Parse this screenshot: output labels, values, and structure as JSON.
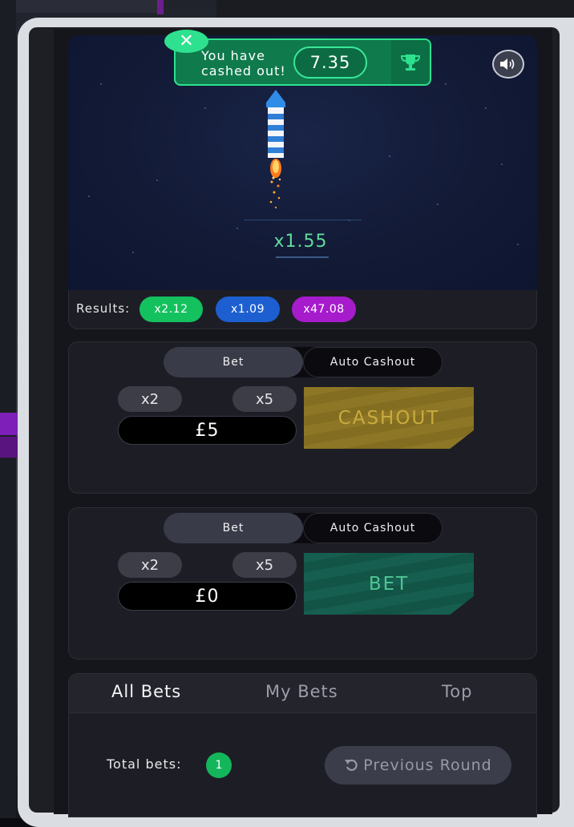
{
  "game": {
    "cashed_out": {
      "text_line1": "You have",
      "text_line2": "cashed out!",
      "value": "7.35"
    },
    "multiplier": "x1.55"
  },
  "results": {
    "label": "Results:",
    "items": [
      {
        "value": "x2.12",
        "color": "#14c15f"
      },
      {
        "value": "x1.09",
        "color": "#1d5fd0"
      },
      {
        "value": "x47.08",
        "color": "#a61bcc"
      }
    ]
  },
  "panels": [
    {
      "tab_bet": "Bet",
      "tab_auto": "Auto Cashout",
      "quick1": "x2",
      "quick2": "x5",
      "amount": "£5",
      "action": "CASHOUT"
    },
    {
      "tab_bet": "Bet",
      "tab_auto": "Auto Cashout",
      "quick1": "x2",
      "quick2": "x5",
      "amount": "£0",
      "action": "BET"
    }
  ],
  "bets": {
    "tabs": [
      "All Bets",
      "My Bets",
      "Top"
    ],
    "total_label": "Total bets:",
    "total_count": "1",
    "previous_round": "Previous Round"
  }
}
